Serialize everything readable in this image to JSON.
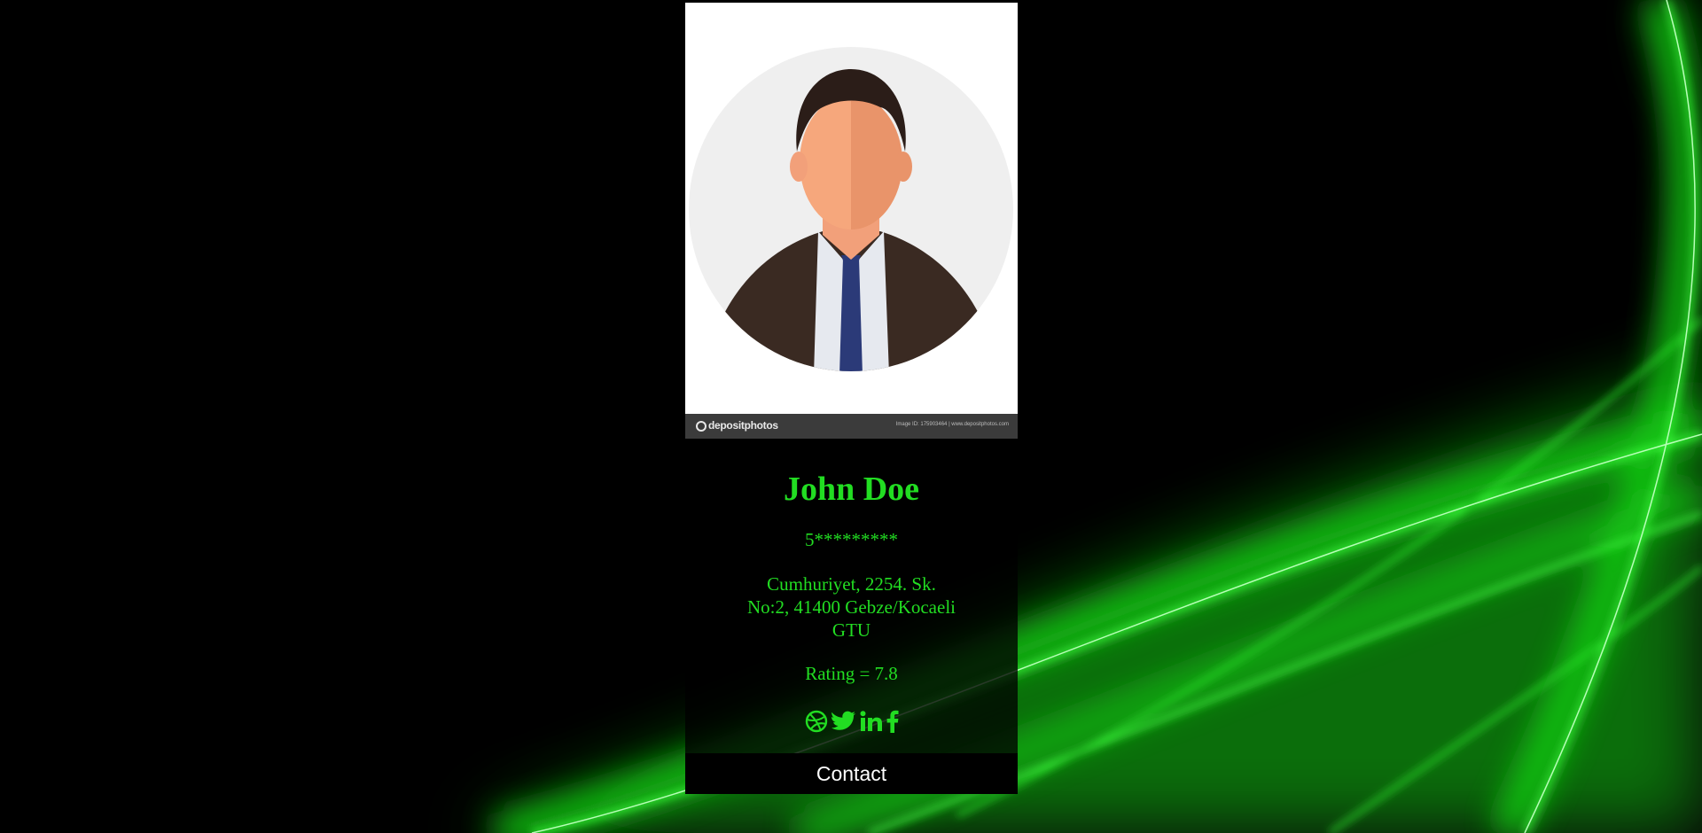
{
  "profile": {
    "name": "John Doe",
    "phone": "5*********",
    "address_line1": "Cumhuriyet, 2254. Sk.",
    "address_line2": "No:2, 41400 Gebze/Kocaeli",
    "address_line3": "GTU",
    "rating": "Rating = 7.8"
  },
  "photo": {
    "brand": "depositphotos",
    "meta": "Image ID: 175903464  |  www.depositphotos.com"
  },
  "socials": [
    {
      "icon": "dribbble-icon"
    },
    {
      "icon": "twitter-icon"
    },
    {
      "icon": "linkedin-icon"
    },
    {
      "icon": "facebook-icon"
    }
  ],
  "contact_button": {
    "label": "Contact"
  },
  "colors": {
    "accent": "#22dd22",
    "background": "#000000",
    "button_bg": "#000000",
    "button_text": "#ffffff"
  }
}
